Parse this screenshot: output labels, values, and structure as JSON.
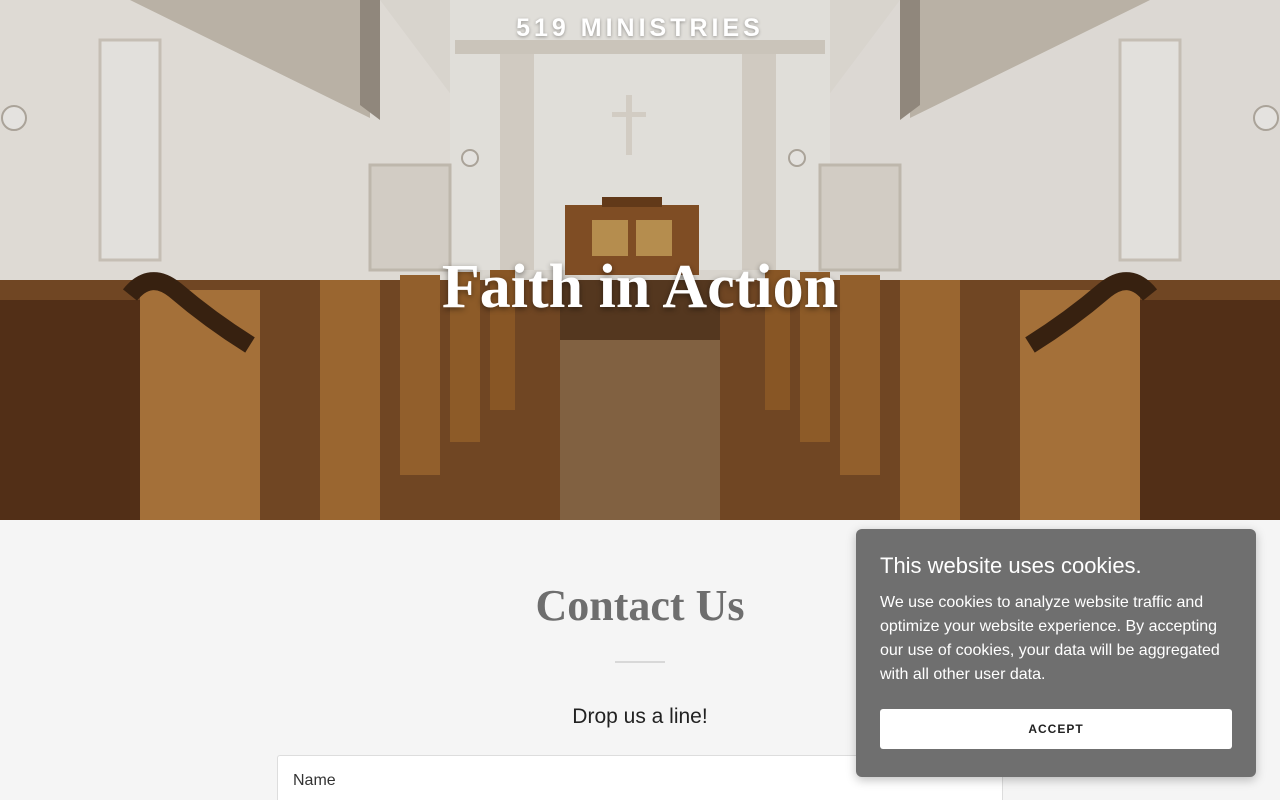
{
  "header": {
    "brand": "519 MINISTRIES"
  },
  "hero": {
    "title": "Faith in Action"
  },
  "contact": {
    "title": "Contact Us",
    "subtitle": "Drop us a line!",
    "name_label": "Name"
  },
  "cookie_banner": {
    "title": "This website uses cookies.",
    "text": "We use cookies to analyze website traffic and optimize your website experience. By accepting our use of cookies, your data will be aggregated with all other user data.",
    "accept_label": "ACCEPT"
  }
}
